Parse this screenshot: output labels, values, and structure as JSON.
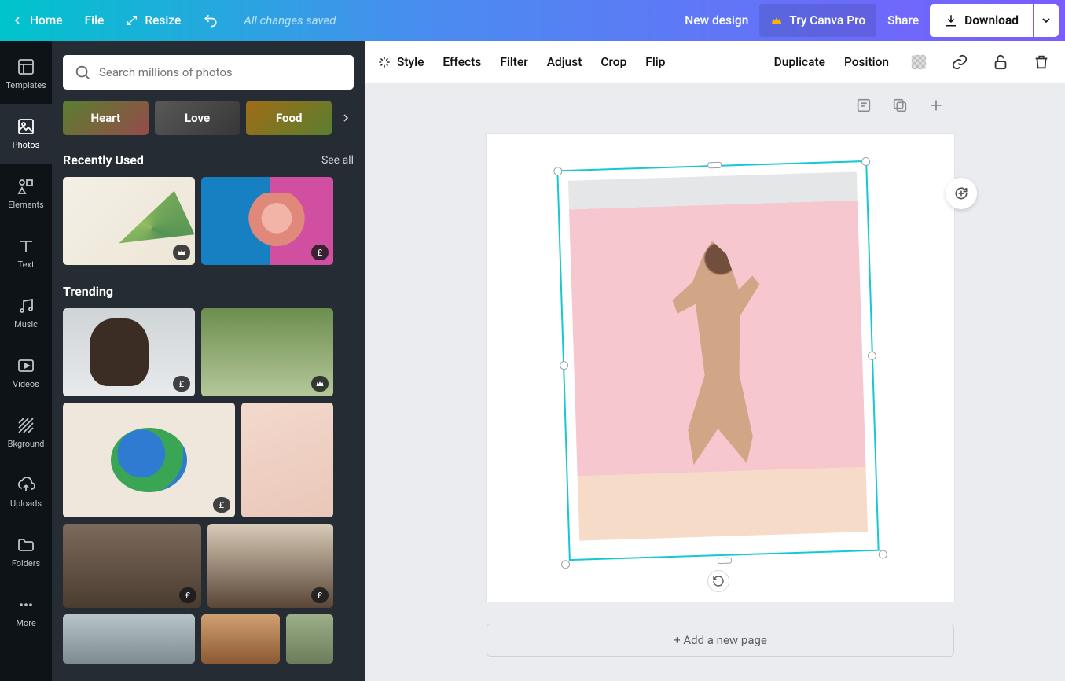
{
  "topbar": {
    "home": "Home",
    "file": "File",
    "resize": "Resize",
    "status": "All changes saved",
    "new_design": "New design",
    "try_pro": "Try Canva Pro",
    "share": "Share",
    "download": "Download"
  },
  "rail": {
    "items": [
      {
        "id": "templates",
        "label": "Templates"
      },
      {
        "id": "photos",
        "label": "Photos"
      },
      {
        "id": "elements",
        "label": "Elements"
      },
      {
        "id": "text",
        "label": "Text"
      },
      {
        "id": "music",
        "label": "Music"
      },
      {
        "id": "videos",
        "label": "Videos"
      },
      {
        "id": "bkground",
        "label": "Bkground"
      },
      {
        "id": "uploads",
        "label": "Uploads"
      },
      {
        "id": "folders",
        "label": "Folders"
      },
      {
        "id": "more",
        "label": "More"
      }
    ],
    "active": "photos"
  },
  "panel": {
    "search_placeholder": "Search millions of photos",
    "pills": [
      {
        "label": "Heart"
      },
      {
        "label": "Love"
      },
      {
        "label": "Food"
      }
    ],
    "recent": {
      "title": "Recently Used",
      "see_all": "See all"
    },
    "trending": {
      "title": "Trending"
    },
    "badge_paid": "£"
  },
  "ctx": {
    "style": "Style",
    "effects": "Effects",
    "filter": "Filter",
    "adjust": "Adjust",
    "crop": "Crop",
    "flip": "Flip",
    "duplicate": "Duplicate",
    "position": "Position"
  },
  "canvas": {
    "add_page": "+ Add a new page"
  }
}
